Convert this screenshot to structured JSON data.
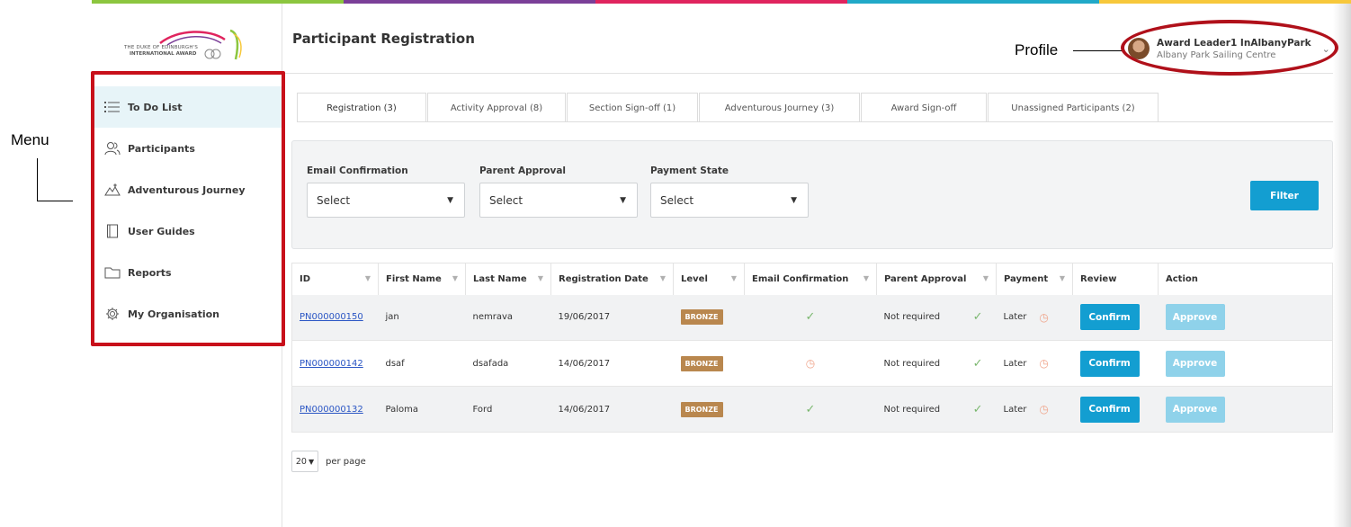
{
  "colors": {
    "stripe": [
      "#8cc63f",
      "#7b3f98",
      "#e0245e",
      "#21a9c8",
      "#f7c83b"
    ],
    "accent": "#139ed1",
    "approve_disabled": "#8fd2ea",
    "badge_bronze": "#b9874e",
    "annotation_red": "#c8101a"
  },
  "logo": {
    "line1": "THE DUKE OF EDINBURGH'S",
    "line2": "INTERNATIONAL AWARD"
  },
  "annotations": {
    "menu": "Menu",
    "profile": "Profile"
  },
  "header": {
    "title": "Participant Registration",
    "profile": {
      "name": "Award Leader1 InAlbanyPark",
      "org": "Albany Park Sailing Centre",
      "icon": "chevron-down-icon"
    }
  },
  "sidebar": {
    "items": [
      {
        "label": "To Do List",
        "icon": "list-icon",
        "active": true
      },
      {
        "label": "Participants",
        "icon": "participants-icon"
      },
      {
        "label": "Adventurous Journey",
        "icon": "mountain-icon"
      },
      {
        "label": "User Guides",
        "icon": "book-icon"
      },
      {
        "label": "Reports",
        "icon": "folder-icon"
      },
      {
        "label": "My Organisation",
        "icon": "gear-icon"
      }
    ]
  },
  "tabs": [
    {
      "label": "Registration (3)",
      "active": true
    },
    {
      "label": "Activity Approval (8)"
    },
    {
      "label": "Section Sign-off (1)"
    },
    {
      "label": "Adventurous Journey (3)"
    },
    {
      "label": "Award Sign-off"
    },
    {
      "label": "Unassigned Participants (2)"
    }
  ],
  "filters": {
    "email_label": "Email Confirmation",
    "email_value": "Select",
    "parent_label": "Parent Approval",
    "parent_value": "Select",
    "payment_label": "Payment State",
    "payment_value": "Select",
    "filter_button": "Filter"
  },
  "table": {
    "columns": [
      "ID",
      "First Name",
      "Last Name",
      "Registration Date",
      "Level",
      "Email Confirmation",
      "Parent Approval",
      "Payment",
      "Review",
      "Action"
    ],
    "rows": [
      {
        "id": "PN000000150",
        "first": "jan",
        "last": "nemrava",
        "date": "19/06/2017",
        "level": "BRONZE",
        "email_status": "confirmed",
        "parent": "Not required",
        "parent_status": "confirmed",
        "payment": "Later",
        "payment_status": "pending",
        "review": "Confirm",
        "action": "Approve"
      },
      {
        "id": "PN000000142",
        "first": "dsaf",
        "last": "dsafada",
        "date": "14/06/2017",
        "level": "BRONZE",
        "email_status": "pending",
        "parent": "Not required",
        "parent_status": "confirmed",
        "payment": "Later",
        "payment_status": "pending",
        "review": "Confirm",
        "action": "Approve"
      },
      {
        "id": "PN000000132",
        "first": "Paloma",
        "last": "Ford",
        "date": "14/06/2017",
        "level": "BRONZE",
        "email_status": "confirmed",
        "parent": "Not required",
        "parent_status": "confirmed",
        "payment": "Later",
        "payment_status": "pending",
        "review": "Confirm",
        "action": "Approve"
      }
    ]
  },
  "pager": {
    "page_size": "20",
    "label": "per page"
  }
}
